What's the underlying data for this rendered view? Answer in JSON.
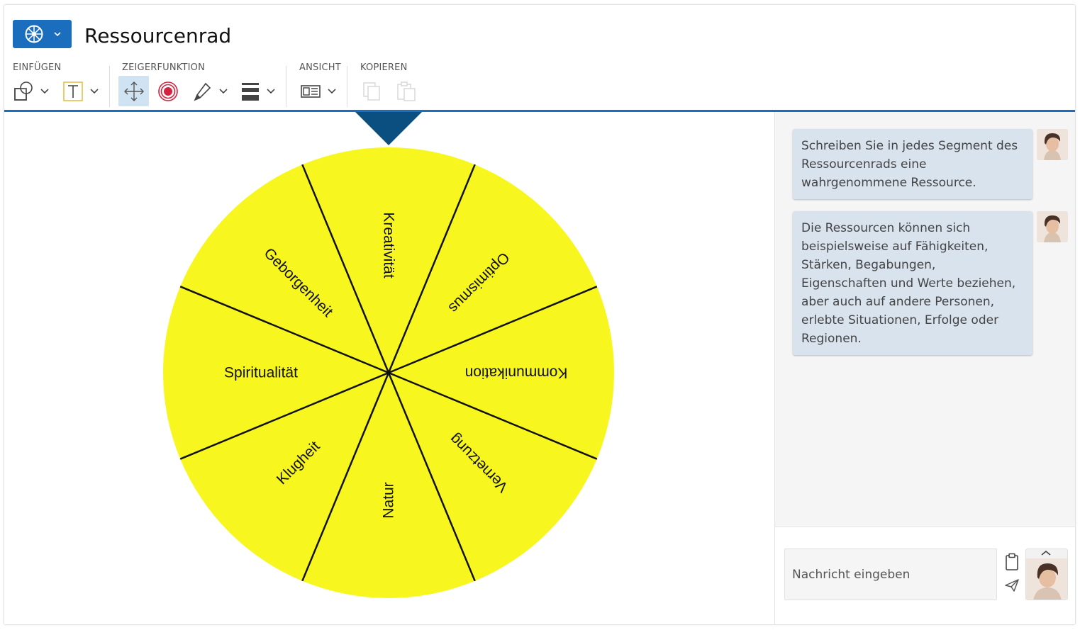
{
  "app": {
    "title": "Ressourcenrad",
    "app_icon": "wheel-icon",
    "accent_color": "#1a6ebd"
  },
  "toolbar": {
    "groups": {
      "insert": "EINFÜGEN",
      "pointer": "ZEIGERFUNKTION",
      "view": "ANSICHT",
      "copy": "KOPIEREN"
    },
    "tools": [
      {
        "name": "shapes",
        "icon": "shapes-icon"
      },
      {
        "name": "text",
        "icon": "text-icon"
      },
      {
        "name": "move",
        "icon": "move-icon",
        "active": true
      },
      {
        "name": "target",
        "icon": "target-icon"
      },
      {
        "name": "pen",
        "icon": "pen-icon"
      },
      {
        "name": "line-style",
        "icon": "line-weight-icon"
      },
      {
        "name": "view",
        "icon": "view-icon"
      },
      {
        "name": "copy",
        "icon": "copy-icon",
        "disabled": true
      },
      {
        "name": "paste",
        "icon": "paste-icon",
        "disabled": true
      }
    ]
  },
  "wheel": {
    "fill_color": "#f7f71f",
    "pointer_color": "#0b4f80",
    "segments": [
      "Kreativität",
      "Optimismus",
      "Kommunikation",
      "Vernetzung",
      "Natur",
      "Klugheit",
      "Spiritualität",
      "Geborgenheit"
    ]
  },
  "chat": {
    "messages": [
      {
        "text": "Schreiben Sie in jedes Segment des Ressourcenrads eine wahrgenommene Ressource."
      },
      {
        "text": "Die Ressourcen können sich beispielsweise auf Fähigkeiten, Stärken, Begabungen, Eigenschaften und Werte beziehen, aber auch auf andere Personen, erlebte Situationen, Erfolge oder Regionen."
      }
    ],
    "input_placeholder": "Nachricht eingeben"
  }
}
